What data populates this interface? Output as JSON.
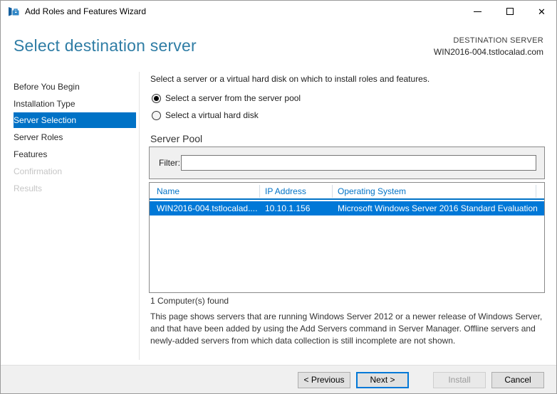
{
  "window": {
    "title": "Add Roles and Features Wizard",
    "controls": {
      "minimize_icon": "minimize-icon",
      "maximize_icon": "maximize-icon",
      "close_icon": "close-icon",
      "close_glyph": "✕"
    }
  },
  "header": {
    "title": "Select destination server",
    "destination_label": "DESTINATION SERVER",
    "destination_server": "WIN2016-004.tstlocalad.com"
  },
  "sidebar": {
    "items": [
      {
        "label": "Before You Begin",
        "state": "enabled"
      },
      {
        "label": "Installation Type",
        "state": "enabled"
      },
      {
        "label": "Server Selection",
        "state": "selected"
      },
      {
        "label": "Server Roles",
        "state": "enabled"
      },
      {
        "label": "Features",
        "state": "enabled"
      },
      {
        "label": "Confirmation",
        "state": "disabled"
      },
      {
        "label": "Results",
        "state": "disabled"
      }
    ]
  },
  "main": {
    "intro": "Select a server or a virtual hard disk on which to install roles and features.",
    "radios": [
      {
        "label": "Select a server from the server pool",
        "selected": true
      },
      {
        "label": "Select a virtual hard disk",
        "selected": false
      }
    ],
    "server_pool": {
      "heading": "Server Pool",
      "filter_label": "Filter:",
      "filter_value": "",
      "table": {
        "columns": [
          "Name",
          "IP Address",
          "Operating System"
        ],
        "rows": [
          {
            "name": "WIN2016-004.tstlocalad....",
            "ip_address": "10.10.1.156",
            "operating_system": "Microsoft Windows Server 2016 Standard Evaluation",
            "selected": true
          }
        ]
      },
      "count_text": "1 Computer(s) found"
    },
    "description": "This page shows servers that are running Windows Server 2012 or a newer release of Windows Server, and that have been added by using the Add Servers command in Server Manager. Offline servers and newly-added servers from which data collection is still incomplete are not shown."
  },
  "footer": {
    "buttons": [
      {
        "label": "< Previous",
        "state": "enabled"
      },
      {
        "label": "Next >",
        "state": "default"
      },
      {
        "label": "Install",
        "state": "disabled"
      },
      {
        "label": "Cancel",
        "state": "enabled"
      }
    ]
  },
  "colors": {
    "accent_blue": "#0072c6",
    "selection_blue": "#0078d7",
    "header_title_blue": "#2f7da5",
    "footer_bg": "#f0f0f0"
  }
}
